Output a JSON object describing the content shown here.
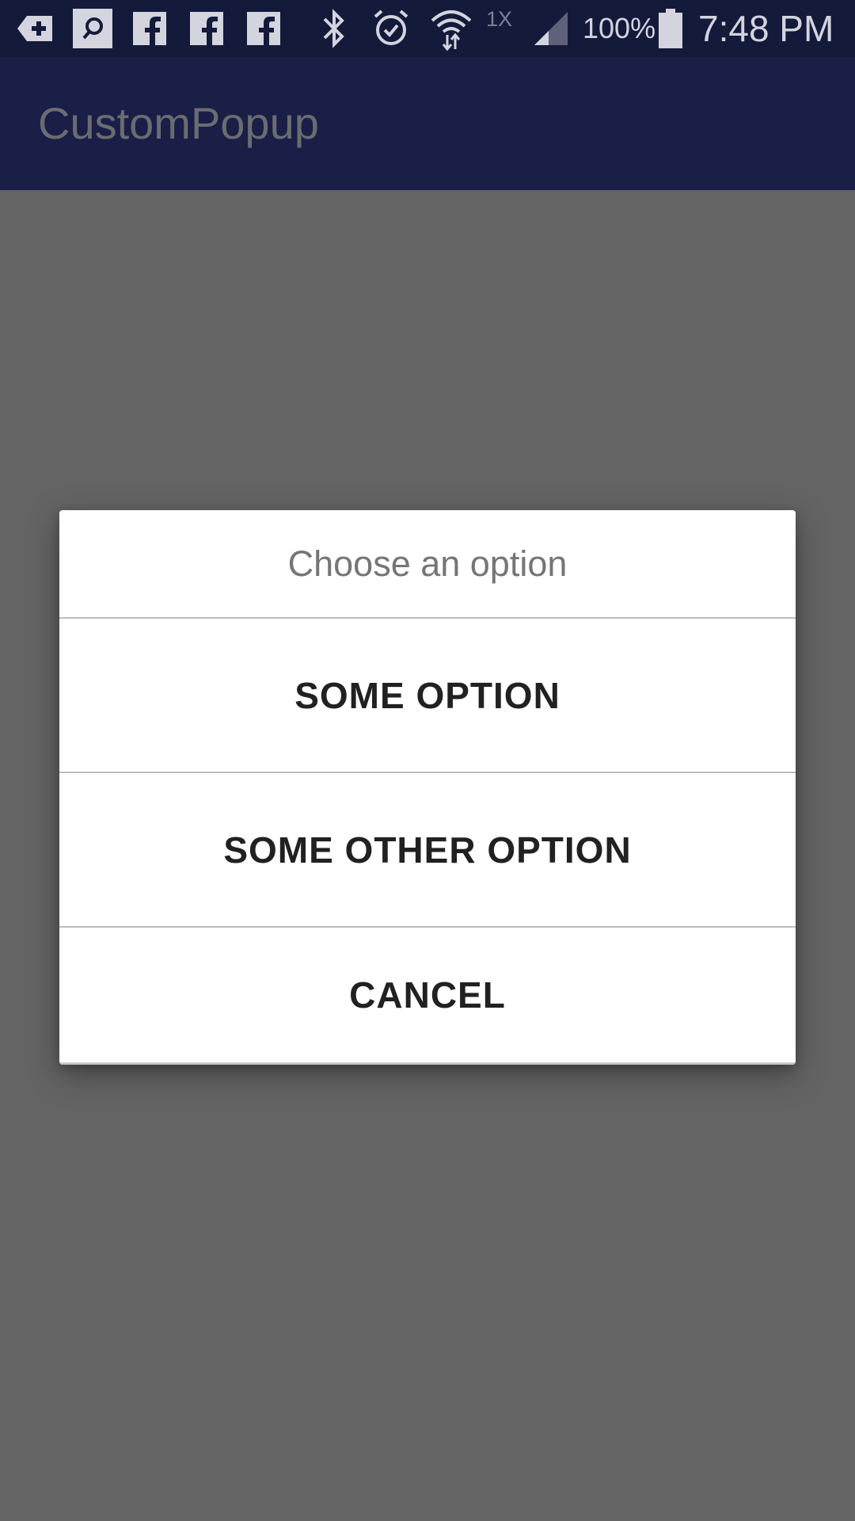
{
  "status_bar": {
    "icons": [
      "add-box-icon",
      "search-box-icon",
      "facebook-icon",
      "facebook-icon",
      "facebook-icon",
      "bluetooth-icon",
      "alarm-icon",
      "wifi-icon",
      "signal-icon",
      "battery-icon"
    ],
    "network_label": "1X",
    "battery_percent": "100%",
    "time": "7:48 PM"
  },
  "app_bar": {
    "title": "CustomPopup"
  },
  "dialog": {
    "title": "Choose an option",
    "options": [
      {
        "label": "SOME OPTION"
      },
      {
        "label": "SOME OTHER OPTION"
      },
      {
        "label": "CANCEL"
      }
    ]
  },
  "colors": {
    "status_bar_bg": "#141a3a",
    "app_bar_bg": "#1a1f48",
    "scrim": "#646464",
    "dialog_bg": "#ffffff",
    "divider": "#bdbdbd"
  }
}
